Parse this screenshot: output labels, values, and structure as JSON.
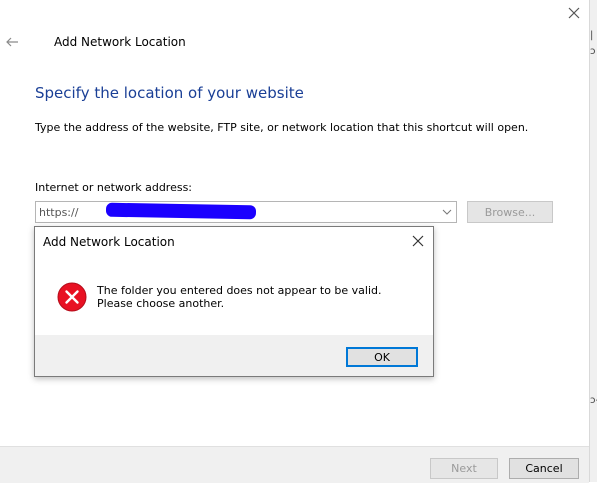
{
  "wizard": {
    "title": "Add Network Location",
    "heading": "Specify the location of your website",
    "description": "Type the address of the website, FTP site, or network location that this shortcut will open.",
    "address_label": "Internet or network address:",
    "address_value": "https://",
    "browse_label": "Browse...",
    "next_label": "Next",
    "cancel_label": "Cancel",
    "heading_color": "#1a3f96"
  },
  "error_dialog": {
    "title": "Add Network Location",
    "message": "The folder you entered does not appear to be valid.  Please choose another.",
    "ok_label": "OK",
    "icon": "error-icon",
    "icon_color": "#e81123"
  },
  "background_window": {
    "edge_text_1": "|",
    "edge_text_2": "ɔ",
    "edge_text_3": "ɔ-"
  }
}
